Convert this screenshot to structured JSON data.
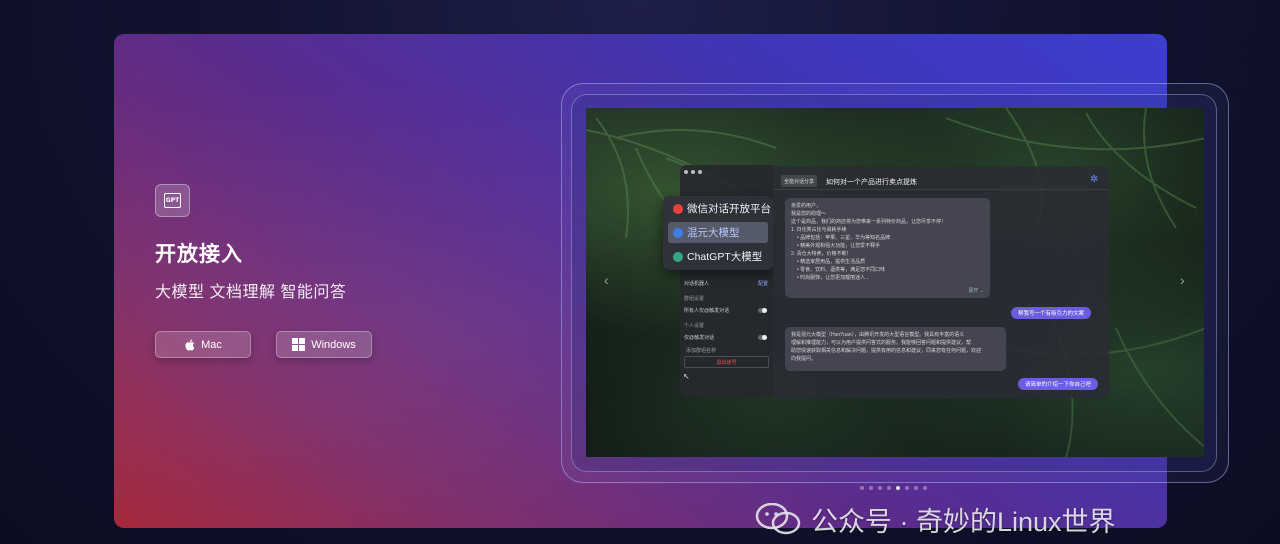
{
  "hero": {
    "badge_text": "GPT",
    "title": "开放接入",
    "subtitle": "大模型 文档理解 智能问答",
    "buttons": {
      "mac_label": "Mac",
      "windows_label": "Windows"
    }
  },
  "app_preview": {
    "menu_items": [
      {
        "label": "微信对话开放平台",
        "icon_color": "#e8413c"
      },
      {
        "label": "混元大模型",
        "icon_color": "#3f7de8"
      },
      {
        "label": "ChatGPT大模型",
        "icon_color": "#35a683"
      }
    ],
    "selected_menu_index": 1,
    "settings": {
      "section_label": "对话机器人",
      "section_action": "配置",
      "group_label": "群组设置",
      "group_option": "所有人仅@触发对话",
      "personal_label": "个人设置",
      "personal_option": "仅@触发对话",
      "extra_label": "添加群组名称",
      "logout_label": "退出账号"
    },
    "chat": {
      "tag": "全能对话分享",
      "query": "如何对一个产品进行卖点提炼",
      "ai_reply_1": [
        "亲爱的用户，",
        "我是您的助理～",
        "这个是商品，我们的商店将为您带来一系列特价商品，让您尽享不停！",
        "1. 日化类占比与易耗手续",
        "   • 品牌包括：苹果、三星、华为等知名品牌",
        "   • 精美外观和强大功能，让您爱不释手",
        "2. 清仓大特卖，价格不断！",
        "   • 精选家居用品，提供生活品质",
        "   • 零食、饮料、酒类等，满足您不同口味",
        "   • 时尚服饰，让您更加靓丽迷人..."
      ],
      "ai_reply_1_more": "展开 ⌄",
      "user_msg_1": "帮我写一个有吸引力的文案",
      "ai_reply_2": [
        "我是混元大模型（HunYuan），由腾讯开发的大型语言模型。我具有丰富的语义",
        "理解和推理能力，可以为用户提供问答式的服务。我能够回答问题和提供建议，帮",
        "助您快速获取相关信息和解决问题，提供有用的信息和建议，同来您有任何问题，欢迎",
        "向我提问。"
      ],
      "user_msg_2": "请简单的介绍一下你自己吧"
    },
    "carousel": {
      "dot_count": 8,
      "active_index": 4
    }
  },
  "watermark": {
    "text": "公众号 · 奇妙的Linux世界"
  }
}
